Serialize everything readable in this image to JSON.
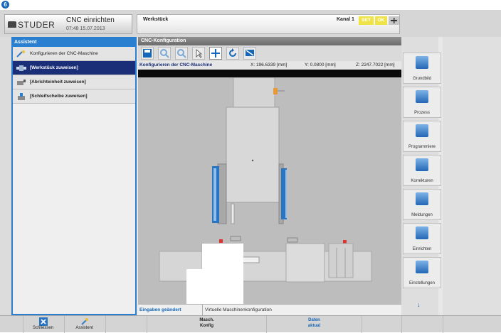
{
  "step_badge": "6",
  "brand": {
    "logo_text": "STUDER",
    "title": "CNC einrichten",
    "timestamp": "07:48 15.07.2013"
  },
  "header": {
    "workpiece_label": "Werkstück",
    "channel_label": "Kanal 1",
    "set_label": "SET",
    "ok_label": "OK",
    "menu_icon": "menu-icon"
  },
  "assistant": {
    "title": "Assistent",
    "items": [
      {
        "label": "Konfigurieren der CNC-Maschine",
        "icon": "wizard-icon"
      },
      {
        "label": "[Werkstück zuweisen]",
        "icon": "workpiece-icon"
      },
      {
        "label": "[Abrichteinheit zuweisen]",
        "icon": "dresser-icon"
      },
      {
        "label": "[Schleifscheibe zuweisen]",
        "icon": "wheel-icon"
      }
    ]
  },
  "cnc": {
    "title": "CNC-Konfiguration",
    "toolbar": [
      "save-icon",
      "zoom-in-icon",
      "zoom-out-icon",
      "pointer-icon",
      "move-icon",
      "rotate-icon",
      "view-icon"
    ],
    "status_title": "Konfigurieren der CNC-Maschine",
    "coord_x": "X: 196.6339 [mm]",
    "coord_y": "Y: 0.0800 [mm]",
    "coord_z": "Z: 2247.7022 [mm]",
    "footer_changed": "Eingaben geändert",
    "footer_config": "Virtuelle Maschinenkonfiguration"
  },
  "rightnav": {
    "items": [
      {
        "label": "Grundbild",
        "icon": "home-icon"
      },
      {
        "label": "Prozess",
        "icon": "process-icon"
      },
      {
        "label": "Programmiere",
        "icon": "program-icon"
      },
      {
        "label": "Korrekturen",
        "icon": "corrections-icon"
      },
      {
        "label": "Meldungen",
        "icon": "messages-icon"
      },
      {
        "label": "Einrichten",
        "icon": "setup-icon"
      },
      {
        "label": "Einstellungen",
        "icon": "settings-icon"
      }
    ],
    "more_glyph": "↓"
  },
  "bottombar": {
    "close_label": "Schliessen",
    "assistant_label": "Assistent",
    "machine_config_line1": "Masch.",
    "machine_config_line2": "Konfig",
    "data_line1": "Daten",
    "data_line2": "aktual"
  },
  "colors": {
    "accent_blue": "#2a7fd0",
    "active_item": "#1a2f78",
    "highlight_yellow": "#f0e34a",
    "wheel_blue": "#1e6fc8"
  }
}
